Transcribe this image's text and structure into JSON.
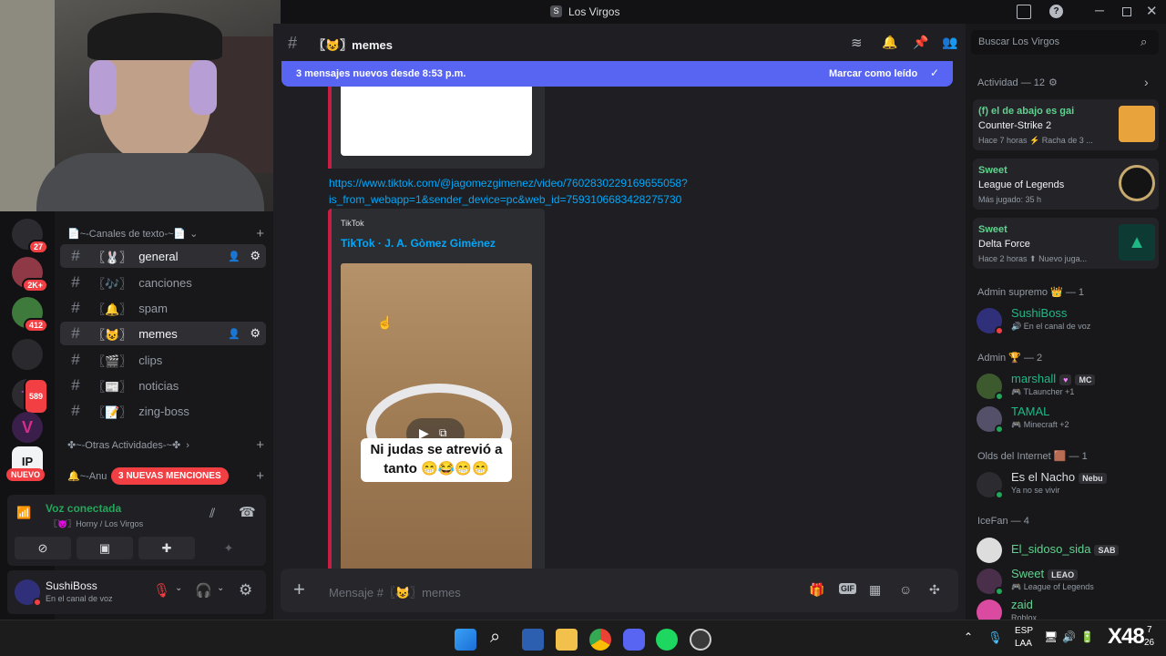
{
  "window": {
    "title": "Los Virgos",
    "app_icon": "discord-icon"
  },
  "channel_header": {
    "name": "〖😺〗memes",
    "search_placeholder": "Buscar Los Virgos"
  },
  "new_messages_bar": {
    "text": "3 mensajes nuevos desde 8:53 p.m.",
    "action": "Marcar como leído",
    "color": "#5865f2"
  },
  "servers": [
    {
      "badge": "27"
    },
    {
      "badge": "2K+"
    },
    {
      "badge": "412"
    },
    {
      "badge": ""
    },
    {
      "badge": "589"
    },
    {
      "badge": ""
    },
    {
      "badge": "",
      "label": "NUEVO"
    }
  ],
  "channel_list": {
    "categories": [
      "📄~-Canales de texto-~📄",
      "✤~-Otras Actividades-~✤",
      "🔔~-Anu"
    ],
    "channels": [
      {
        "emoji": "〖🐰〗",
        "name": "general",
        "selected": true
      },
      {
        "emoji": "〖🎶〗",
        "name": "canciones",
        "selected": false
      },
      {
        "emoji": "〖🔔〗",
        "name": "spam",
        "selected": false
      },
      {
        "emoji": "〖😺〗",
        "name": "memes",
        "selected": true
      },
      {
        "emoji": "〖🎬〗",
        "name": "clips",
        "selected": false
      },
      {
        "emoji": "〖📰〗",
        "name": "noticias",
        "selected": false
      },
      {
        "emoji": "〖📝〗",
        "name": "zing-boss",
        "selected": false
      }
    ],
    "mentions_badge": "3 NUEVAS MENCIONES"
  },
  "voice": {
    "status": "Voz conectada",
    "channel": "〖😈〗Horny / Los Virgos"
  },
  "user_panel": {
    "name": "SushiBoss",
    "status": "En el canal de voz"
  },
  "message": {
    "link_line1": "https://www.tiktok.com/@jagomezgimenez/video/7602830229169655058?",
    "link_line2": "is_from_webapp=1&sender_device=pc&web_id=7593106683428275730",
    "embed_provider": "TikTok",
    "embed_title": "TikTok · J. A. Gòmez Gimènez",
    "video_caption_line1": "Ni judas se atrevió a",
    "video_caption_line2": "tanto 😁😂😁😁"
  },
  "composer": {
    "placeholder": "Mensaje #〖😺〗memes"
  },
  "activity": {
    "header": "Actividad — 12",
    "items": [
      {
        "user": "(f) el de abajo es gai",
        "game": "Counter-Strike 2",
        "meta": "Hace 7 horas   ⚡ Racha de 3 ...",
        "color": "#e8a33d"
      },
      {
        "user": "Sweet",
        "game": "League of Legends",
        "meta": "Más jugado: 35 h",
        "color": "#c8aa6e"
      },
      {
        "user": "Sweet",
        "game": "Delta Force",
        "meta": "Hace 2 horas   ⬆ Nuevo juga...",
        "color": "#1fb885"
      }
    ]
  },
  "member_groups": [
    {
      "title": "Admin supremo 👑 — 1",
      "members": [
        {
          "name": "SushiBoss",
          "sub": "🔊 En el canal de voz",
          "tag": "",
          "color": "#1fb885"
        }
      ]
    },
    {
      "title": "Admin 🏆 — 2",
      "members": [
        {
          "name": "marshall",
          "sub": "🎮 TLauncher +1",
          "tag": "MC",
          "color": "#1fb885"
        },
        {
          "name": "TAMAL",
          "sub": "🎮 Minecraft +2",
          "tag": "",
          "color": "#1fb885"
        }
      ]
    },
    {
      "title": "Olds del Internet 🟫 — 1",
      "members": [
        {
          "name": "Es el Nacho",
          "sub": "Ya no se vivir",
          "tag": "Nebu",
          "color": "#dbdee1"
        }
      ]
    },
    {
      "title": "IceFan — 4",
      "members": [
        {
          "name": "El_sidoso_sida",
          "sub": "",
          "tag": "SAB",
          "color": "#5fd38d"
        },
        {
          "name": "Sweet",
          "sub": "🎮 League of Legends",
          "tag": "LEAO",
          "color": "#5fd38d"
        },
        {
          "name": "zaid",
          "sub": "Roblox",
          "tag": "",
          "color": "#5fd38d"
        }
      ]
    }
  ],
  "taskbar": {
    "lang1": "ESP",
    "lang2": "LAA",
    "clock1": "7",
    "clock2": "26",
    "watermark": "X48"
  }
}
